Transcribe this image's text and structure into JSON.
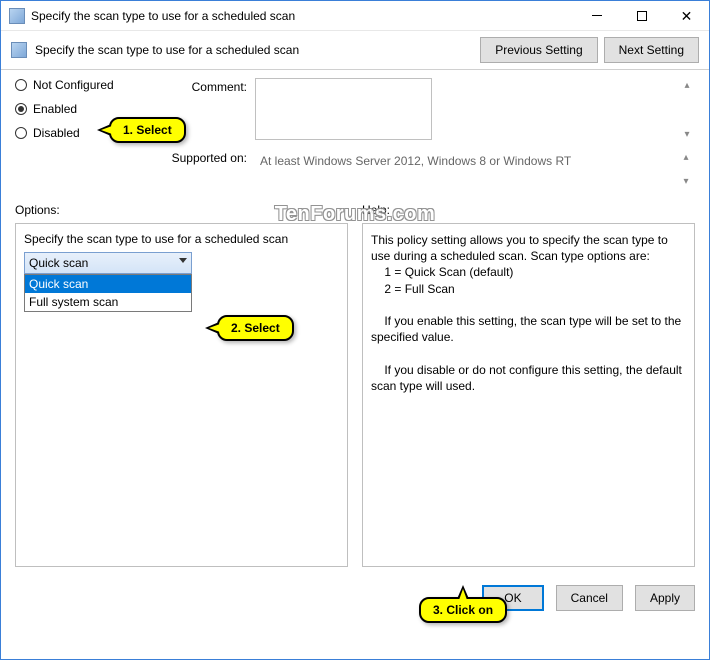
{
  "window": {
    "title": "Specify the scan type to use for a scheduled scan"
  },
  "header": {
    "title": "Specify the scan type to use for a scheduled scan",
    "prev": "Previous Setting",
    "next": "Next Setting"
  },
  "radios": {
    "not_configured": "Not Configured",
    "enabled": "Enabled",
    "disabled": "Disabled"
  },
  "labels": {
    "comment": "Comment:",
    "supported": "Supported on:",
    "options": "Options:",
    "help": "Help:"
  },
  "supported_text": "At least Windows Server 2012, Windows 8 or Windows RT",
  "options": {
    "label": "Specify the scan type to use for a scheduled scan",
    "selected": "Quick scan",
    "items": [
      "Quick scan",
      "Full system scan"
    ]
  },
  "help_text": "This policy setting allows you to specify the scan type to use during a scheduled scan. Scan type options are:\n    1 = Quick Scan (default)\n    2 = Full Scan\n\n    If you enable this setting, the scan type will be set to the specified value.\n\n    If you disable or do not configure this setting, the default scan type will used.",
  "buttons": {
    "ok": "OK",
    "cancel": "Cancel",
    "apply": "Apply"
  },
  "callouts": {
    "c1": "1. Select",
    "c2": "2. Select",
    "c3": "3. Click on"
  },
  "watermark": "TenForums.com"
}
